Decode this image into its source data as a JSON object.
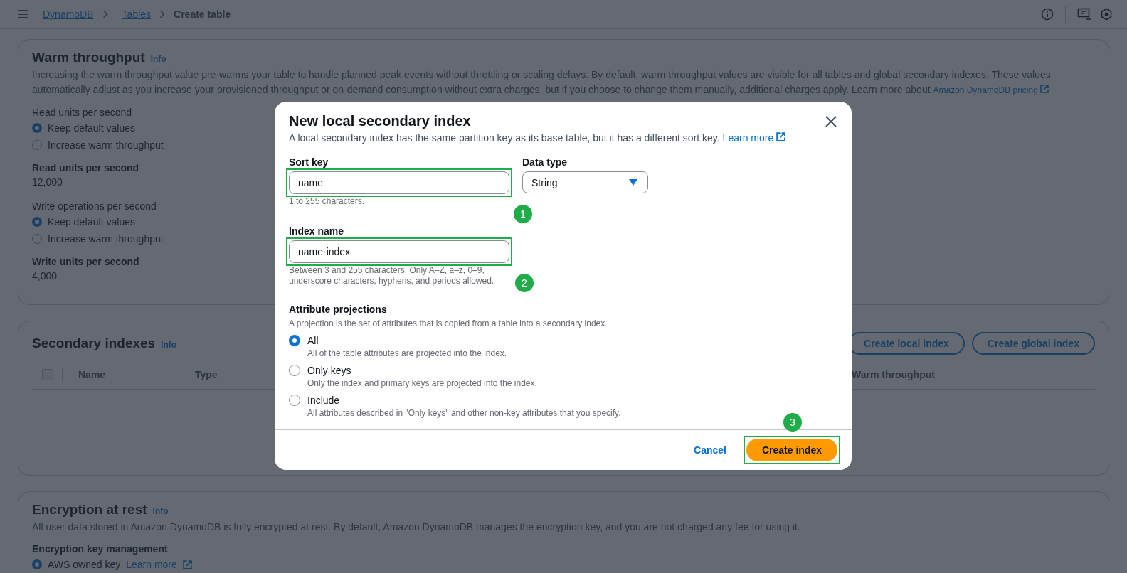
{
  "breadcrumbs": [
    {
      "label": "DynamoDB",
      "link": true
    },
    {
      "label": "Tables",
      "link": true
    },
    {
      "label": "Create table",
      "link": false
    }
  ],
  "warm_throughput": {
    "title": "Warm throughput",
    "info": "Info",
    "description": "Increasing the warm throughput value pre-warms your table to handle planned peak events without throttling or scaling delays. By default, warm throughput values are visible for all tables and global secondary indexes. These values automatically adjust as you increase your provisioned throughput or on-demand consumption without extra charges, but if you choose to change them manually, additional charges apply. Learn more about",
    "link": "Amazon DynamoDB pricing",
    "fields": [
      {
        "kind": "radio",
        "label": "Read units per second",
        "options": [
          {
            "label": "Keep default values",
            "selected": true
          },
          {
            "label": "Increase warm throughput",
            "selected": false
          }
        ]
      },
      {
        "kind": "value",
        "label": "Read units per second",
        "value": "12,000"
      },
      {
        "kind": "radio",
        "label": "Write operations per second",
        "options": [
          {
            "label": "Keep default values",
            "selected": true
          },
          {
            "label": "Increase warm throughput",
            "selected": false
          }
        ]
      },
      {
        "kind": "value",
        "label": "Write units per second",
        "value": "4,000"
      }
    ]
  },
  "secondary_indexes": {
    "title": "Secondary indexes",
    "info": "Info",
    "buttons": [
      "Create local index",
      "Create global index"
    ],
    "select_all_disabled": true,
    "columns": [
      "Name",
      "Type",
      "Warm throughput"
    ]
  },
  "encryption": {
    "title": "Encryption at rest",
    "info": "Info",
    "description": "All user data stored in Amazon DynamoDB is fully encrypted at rest. By default, Amazon DynamoDB manages the encryption key, and you are not charged any fee for using it.",
    "key_label": "Encryption key management",
    "options": [
      {
        "label": "AWS owned key",
        "link": "Learn more",
        "selected": true
      }
    ]
  },
  "modal": {
    "title": "New local secondary index",
    "description": "A local secondary index has the same partition key as its base table, but it has a different sort key.",
    "link": "Learn more",
    "sort_key": {
      "label": "Sort key",
      "value": "name",
      "hint": "1 to 255 characters.",
      "callout": "1"
    },
    "data_type": {
      "label": "Data type",
      "value": "String"
    },
    "index_name": {
      "label": "Index name",
      "value": "name-index",
      "hint": "Between 3 and 255 characters. Only A–Z, a–z, 0–9, underscore characters, hyphens, and periods allowed.",
      "callout": "2"
    },
    "projections": {
      "label": "Attribute projections",
      "description": "A projection is the set of attributes that is copied from a table into a secondary index.",
      "options": [
        {
          "label": "All",
          "hint": "All of the table attributes are projected into the index.",
          "selected": true
        },
        {
          "label": "Only keys",
          "hint": "Only the index and primary keys are projected into the index.",
          "selected": false
        },
        {
          "label": "Include",
          "hint": "All attributes described in \"Only keys\" and other non-key attributes that you specify.",
          "selected": false
        }
      ]
    },
    "cancel": "Cancel",
    "submit": {
      "label": "Create index",
      "callout": "3"
    }
  }
}
